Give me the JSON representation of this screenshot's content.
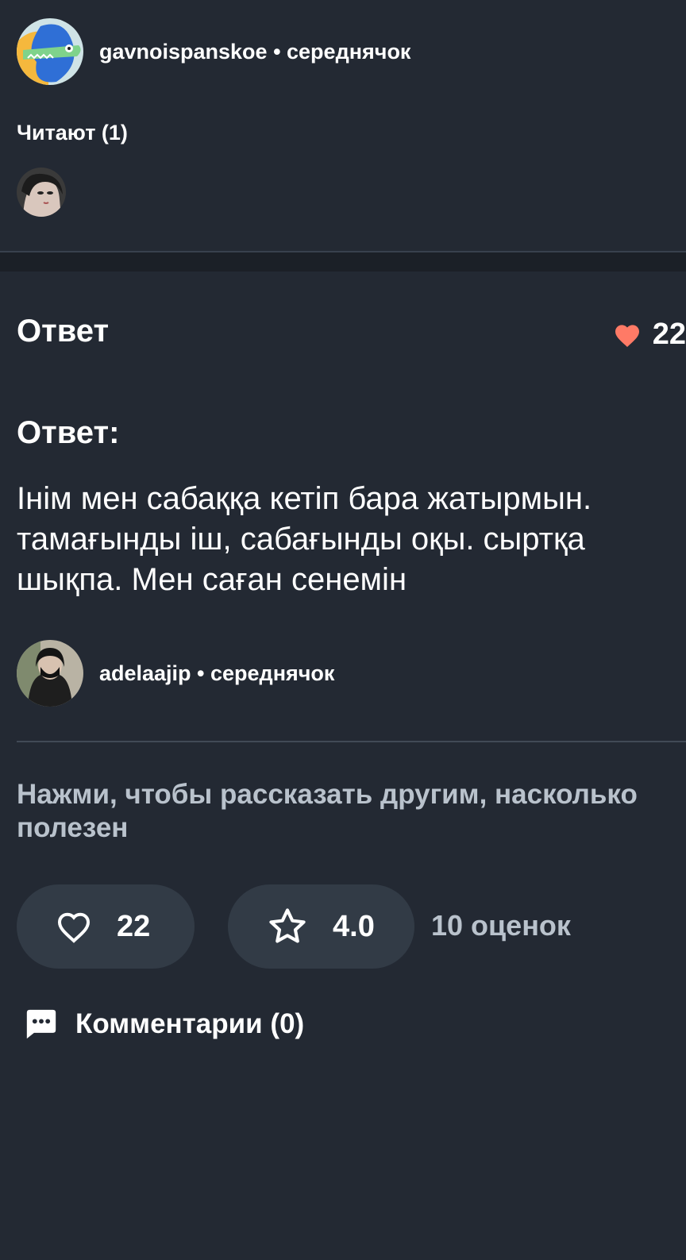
{
  "question_author": {
    "avatar": "cartoon-crocodile-avatar",
    "name_rank": "gavnoispanskoe • середнячок"
  },
  "readers": {
    "title": "Читают (1)",
    "avatars": [
      "user-avatar-photo"
    ]
  },
  "answer": {
    "header": "Ответ",
    "likes": "22",
    "label": "Ответ:",
    "lines": [
      "Інім мен сабаққа кетіп бара жатырмын.",
      "тамағынды іш, сабағынды оқы. сыртқа",
      "шықпа. Мен саған сенемін"
    ],
    "author": {
      "avatar": "user-avatar-photo",
      "name_rank": "adelaajip • середнячок"
    }
  },
  "rating": {
    "prompt_lines": [
      "Нажми, чтобы рассказать другим, насколько",
      "полезен"
    ],
    "like_count": "22",
    "rating_value": "4.0",
    "ratings_count": "10 оценок"
  },
  "comments": {
    "label": "Комментарии (0)"
  },
  "colors": {
    "background": "#232933",
    "heart_accent": "#ff7a66",
    "muted_text": "#b9c2cc",
    "pill_bg": "#323b46"
  }
}
